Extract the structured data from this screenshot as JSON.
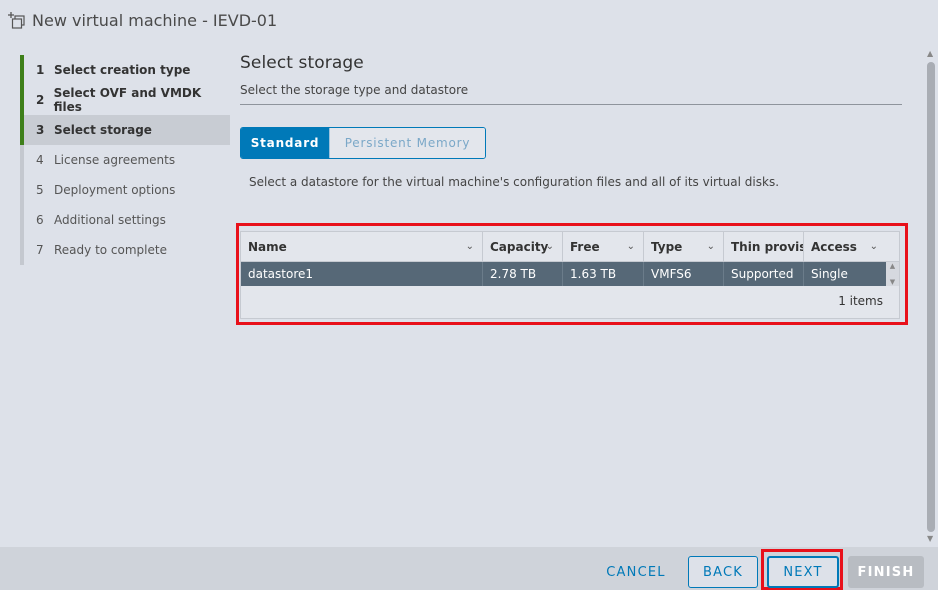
{
  "window": {
    "title": "New virtual machine - IEVD-01"
  },
  "steps": [
    {
      "num": "1",
      "label": "Select creation type"
    },
    {
      "num": "2",
      "label": "Select OVF and VMDK files"
    },
    {
      "num": "3",
      "label": "Select storage"
    },
    {
      "num": "4",
      "label": "License agreements"
    },
    {
      "num": "5",
      "label": "Deployment options"
    },
    {
      "num": "6",
      "label": "Additional settings"
    },
    {
      "num": "7",
      "label": "Ready to complete"
    }
  ],
  "main": {
    "heading": "Select storage",
    "subtitle": "Select the storage type and datastore",
    "tabs": {
      "standard": "Standard",
      "persistent": "Persistent Memory"
    },
    "description": "Select a datastore for the virtual machine's configuration files and all of its virtual disks."
  },
  "grid": {
    "columns": [
      "Name",
      "Capacity",
      "Free",
      "Type",
      "Thin provisioning",
      "Access"
    ],
    "rows": [
      {
        "name": "datastore1",
        "capacity": "2.78 TB",
        "free": "1.63 TB",
        "type": "VMFS6",
        "thin": "Supported",
        "access": "Single"
      }
    ],
    "footer": "1 items"
  },
  "buttons": {
    "cancel": "CANCEL",
    "back": "BACK",
    "next": "NEXT",
    "finish": "FINISH"
  },
  "colors": {
    "accent": "#0079b8",
    "completed_step": "#3e7f1a",
    "selected_row": "#566877",
    "highlight": "#e8101a"
  }
}
